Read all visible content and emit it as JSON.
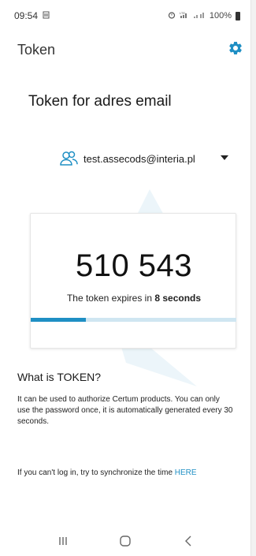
{
  "status_bar": {
    "time": "09:54",
    "battery": "100%"
  },
  "app_bar": {
    "title": "Token",
    "settings_icon": "gear-icon"
  },
  "page": {
    "heading": "Token for adres email"
  },
  "account": {
    "email": "test.assecods@interia.pl",
    "icon": "users-icon"
  },
  "token": {
    "code": "510 543",
    "expiry_prefix": "The token expires in ",
    "expiry_value": "8 seconds",
    "progress_fraction": 0.27
  },
  "info": {
    "title": "What is TOKEN?",
    "body": "It can be used to authorize Certum products. You can only use the password once, it is automatically generated every 30 seconds."
  },
  "sync": {
    "text": "If you can't log in, try to synchronize the time ",
    "link": "HERE"
  },
  "nav": {
    "recents": "recents-icon",
    "home": "home-icon",
    "back": "back-icon"
  },
  "colors": {
    "accent": "#1f8fc4",
    "progress_track": "#cfe6f1"
  }
}
